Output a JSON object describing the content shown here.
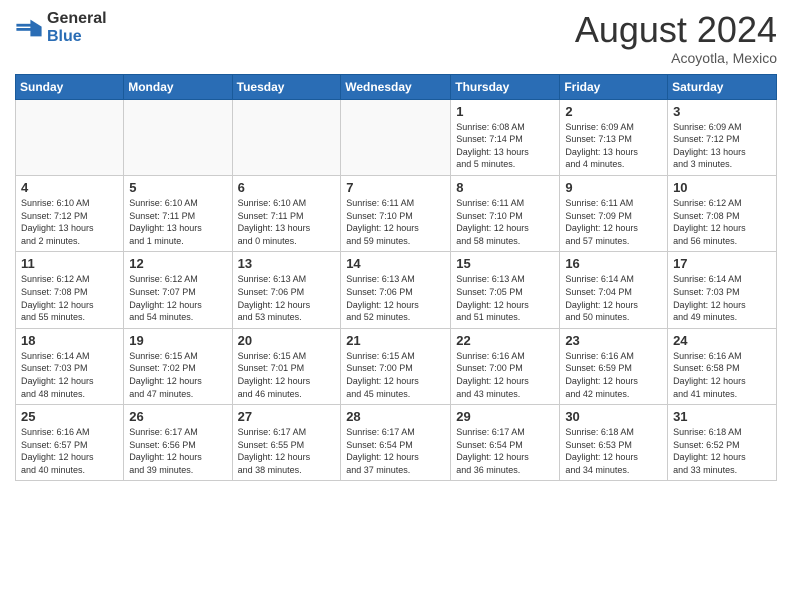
{
  "logo": {
    "general": "General",
    "blue": "Blue"
  },
  "title": {
    "month": "August 2024",
    "location": "Acoyotla, Mexico"
  },
  "weekdays": [
    "Sunday",
    "Monday",
    "Tuesday",
    "Wednesday",
    "Thursday",
    "Friday",
    "Saturday"
  ],
  "weeks": [
    [
      {
        "day": "",
        "info": ""
      },
      {
        "day": "",
        "info": ""
      },
      {
        "day": "",
        "info": ""
      },
      {
        "day": "",
        "info": ""
      },
      {
        "day": "1",
        "info": "Sunrise: 6:08 AM\nSunset: 7:14 PM\nDaylight: 13 hours\nand 5 minutes."
      },
      {
        "day": "2",
        "info": "Sunrise: 6:09 AM\nSunset: 7:13 PM\nDaylight: 13 hours\nand 4 minutes."
      },
      {
        "day": "3",
        "info": "Sunrise: 6:09 AM\nSunset: 7:12 PM\nDaylight: 13 hours\nand 3 minutes."
      }
    ],
    [
      {
        "day": "4",
        "info": "Sunrise: 6:10 AM\nSunset: 7:12 PM\nDaylight: 13 hours\nand 2 minutes."
      },
      {
        "day": "5",
        "info": "Sunrise: 6:10 AM\nSunset: 7:11 PM\nDaylight: 13 hours\nand 1 minute."
      },
      {
        "day": "6",
        "info": "Sunrise: 6:10 AM\nSunset: 7:11 PM\nDaylight: 13 hours\nand 0 minutes."
      },
      {
        "day": "7",
        "info": "Sunrise: 6:11 AM\nSunset: 7:10 PM\nDaylight: 12 hours\nand 59 minutes."
      },
      {
        "day": "8",
        "info": "Sunrise: 6:11 AM\nSunset: 7:10 PM\nDaylight: 12 hours\nand 58 minutes."
      },
      {
        "day": "9",
        "info": "Sunrise: 6:11 AM\nSunset: 7:09 PM\nDaylight: 12 hours\nand 57 minutes."
      },
      {
        "day": "10",
        "info": "Sunrise: 6:12 AM\nSunset: 7:08 PM\nDaylight: 12 hours\nand 56 minutes."
      }
    ],
    [
      {
        "day": "11",
        "info": "Sunrise: 6:12 AM\nSunset: 7:08 PM\nDaylight: 12 hours\nand 55 minutes."
      },
      {
        "day": "12",
        "info": "Sunrise: 6:12 AM\nSunset: 7:07 PM\nDaylight: 12 hours\nand 54 minutes."
      },
      {
        "day": "13",
        "info": "Sunrise: 6:13 AM\nSunset: 7:06 PM\nDaylight: 12 hours\nand 53 minutes."
      },
      {
        "day": "14",
        "info": "Sunrise: 6:13 AM\nSunset: 7:06 PM\nDaylight: 12 hours\nand 52 minutes."
      },
      {
        "day": "15",
        "info": "Sunrise: 6:13 AM\nSunset: 7:05 PM\nDaylight: 12 hours\nand 51 minutes."
      },
      {
        "day": "16",
        "info": "Sunrise: 6:14 AM\nSunset: 7:04 PM\nDaylight: 12 hours\nand 50 minutes."
      },
      {
        "day": "17",
        "info": "Sunrise: 6:14 AM\nSunset: 7:03 PM\nDaylight: 12 hours\nand 49 minutes."
      }
    ],
    [
      {
        "day": "18",
        "info": "Sunrise: 6:14 AM\nSunset: 7:03 PM\nDaylight: 12 hours\nand 48 minutes."
      },
      {
        "day": "19",
        "info": "Sunrise: 6:15 AM\nSunset: 7:02 PM\nDaylight: 12 hours\nand 47 minutes."
      },
      {
        "day": "20",
        "info": "Sunrise: 6:15 AM\nSunset: 7:01 PM\nDaylight: 12 hours\nand 46 minutes."
      },
      {
        "day": "21",
        "info": "Sunrise: 6:15 AM\nSunset: 7:00 PM\nDaylight: 12 hours\nand 45 minutes."
      },
      {
        "day": "22",
        "info": "Sunrise: 6:16 AM\nSunset: 7:00 PM\nDaylight: 12 hours\nand 43 minutes."
      },
      {
        "day": "23",
        "info": "Sunrise: 6:16 AM\nSunset: 6:59 PM\nDaylight: 12 hours\nand 42 minutes."
      },
      {
        "day": "24",
        "info": "Sunrise: 6:16 AM\nSunset: 6:58 PM\nDaylight: 12 hours\nand 41 minutes."
      }
    ],
    [
      {
        "day": "25",
        "info": "Sunrise: 6:16 AM\nSunset: 6:57 PM\nDaylight: 12 hours\nand 40 minutes."
      },
      {
        "day": "26",
        "info": "Sunrise: 6:17 AM\nSunset: 6:56 PM\nDaylight: 12 hours\nand 39 minutes."
      },
      {
        "day": "27",
        "info": "Sunrise: 6:17 AM\nSunset: 6:55 PM\nDaylight: 12 hours\nand 38 minutes."
      },
      {
        "day": "28",
        "info": "Sunrise: 6:17 AM\nSunset: 6:54 PM\nDaylight: 12 hours\nand 37 minutes."
      },
      {
        "day": "29",
        "info": "Sunrise: 6:17 AM\nSunset: 6:54 PM\nDaylight: 12 hours\nand 36 minutes."
      },
      {
        "day": "30",
        "info": "Sunrise: 6:18 AM\nSunset: 6:53 PM\nDaylight: 12 hours\nand 34 minutes."
      },
      {
        "day": "31",
        "info": "Sunrise: 6:18 AM\nSunset: 6:52 PM\nDaylight: 12 hours\nand 33 minutes."
      }
    ]
  ]
}
